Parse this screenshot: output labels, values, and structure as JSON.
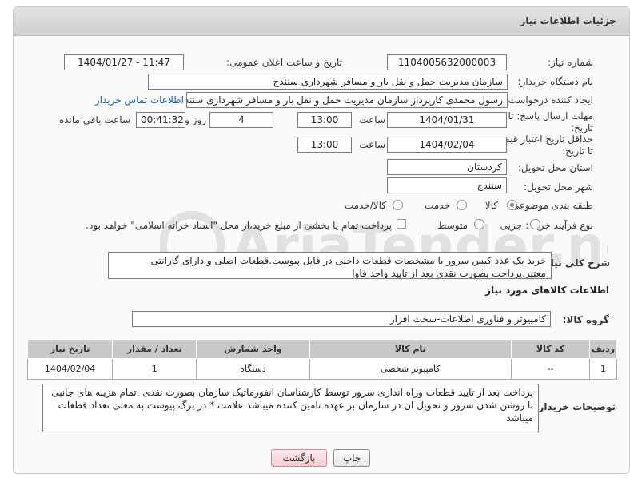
{
  "header": {
    "title": "جزئیات اطلاعات نیاز"
  },
  "fields": {
    "need_number": {
      "label": "شماره نیاز:",
      "value": "1104005632000003"
    },
    "announce_datetime": {
      "label": "تاریخ و ساعت اعلان عمومی:",
      "value": "1404/01/27 - 11:47"
    },
    "buyer_org": {
      "label": "نام دستگاه خریدار:",
      "value": "سازمان مدیریت حمل و نقل بار و مسافر شهرداری سنندج"
    },
    "requester": {
      "label": "ایجاد کننده درخواست:",
      "value": "رسول محمدی کارپرداز سازمان مدیریت حمل و نقل بار و مسافر شهرداری سنندج",
      "contact_link": "اطلاعات تماس خریدار"
    },
    "reply_deadline": {
      "label": "مهلت ارسال پاسخ: تا تاریخ:",
      "date": "1404/01/31",
      "time_label": "ساعت",
      "time": "13:00",
      "days": "4",
      "days_label": "روز و",
      "remaining": "00:41:32",
      "remaining_label": "ساعت باقی مانده"
    },
    "price_validity": {
      "label": "حداقل تاریخ اعتبار قیمت: تا تاریخ:",
      "date": "1404/02/04",
      "time_label": "ساعت",
      "time": "13:00"
    },
    "delivery_province": {
      "label": "استان محل تحویل:",
      "value": "کردستان"
    },
    "delivery_city": {
      "label": "شهر محل تحویل:",
      "value": "سنندج"
    },
    "category": {
      "label": "طبقه بندی موضوعی:",
      "options": [
        "کالا",
        "خدمت",
        "کالا/خدمت"
      ],
      "selected": "کالا"
    },
    "purchase_type": {
      "label": "نوع فرآیند خرید :",
      "options": [
        "جزیی",
        "متوسط"
      ],
      "selected": "جزیی",
      "payment_note": "پرداخت تمام یا بخشی از مبلغ خرید،از محل \"اسناد خزانه اسلامی\" خواهد بود."
    }
  },
  "description": {
    "label": "شرح کلی نیاز:",
    "line1": "خرید یک عدد کیس سرور  با  مشخصات قطعات داخلی در فایل پیوست.قطعات اصلی و دارای گارانتی",
    "line2": "معتبر.پرداخت بصورت نقدی بعد از تایید واحد فاوا"
  },
  "goods_section": {
    "title": "اطلاعات کالاهای مورد نیاز",
    "group_label": "گروه کالا:",
    "group_value": "کامپیوتر و فناوری اطلاعات-سخت افزار",
    "columns": [
      "ردیف",
      "کد کالا",
      "نام کالا",
      "واحد شمارش",
      "تعداد / مقدار",
      "تاریخ نیاز"
    ],
    "rows": [
      {
        "row": "1",
        "code": "--",
        "name": "کامپیوتر شخصی",
        "unit": "دستگاه",
        "qty": "1",
        "date": "1404/02/04"
      }
    ]
  },
  "buyer_notes": {
    "label": "توضیحات خریدار:",
    "text": "پرداخت بعد از تایید قطعات وراه اندازی سرور توسط کارشناسان انفورماتیک سازمان بصورت نقدی .تمام هزینه های جانبی تا روشن شدن سرور و تحویل ان در سازمان بر عهده تامین کننده میباشد.علامت * در برگ پیوست به معنی تعداد قطعات میباشد"
  },
  "buttons": {
    "print": "چاپ",
    "back": "بازگشت"
  },
  "watermark": {
    "text": "AriaTender.neT"
  }
}
